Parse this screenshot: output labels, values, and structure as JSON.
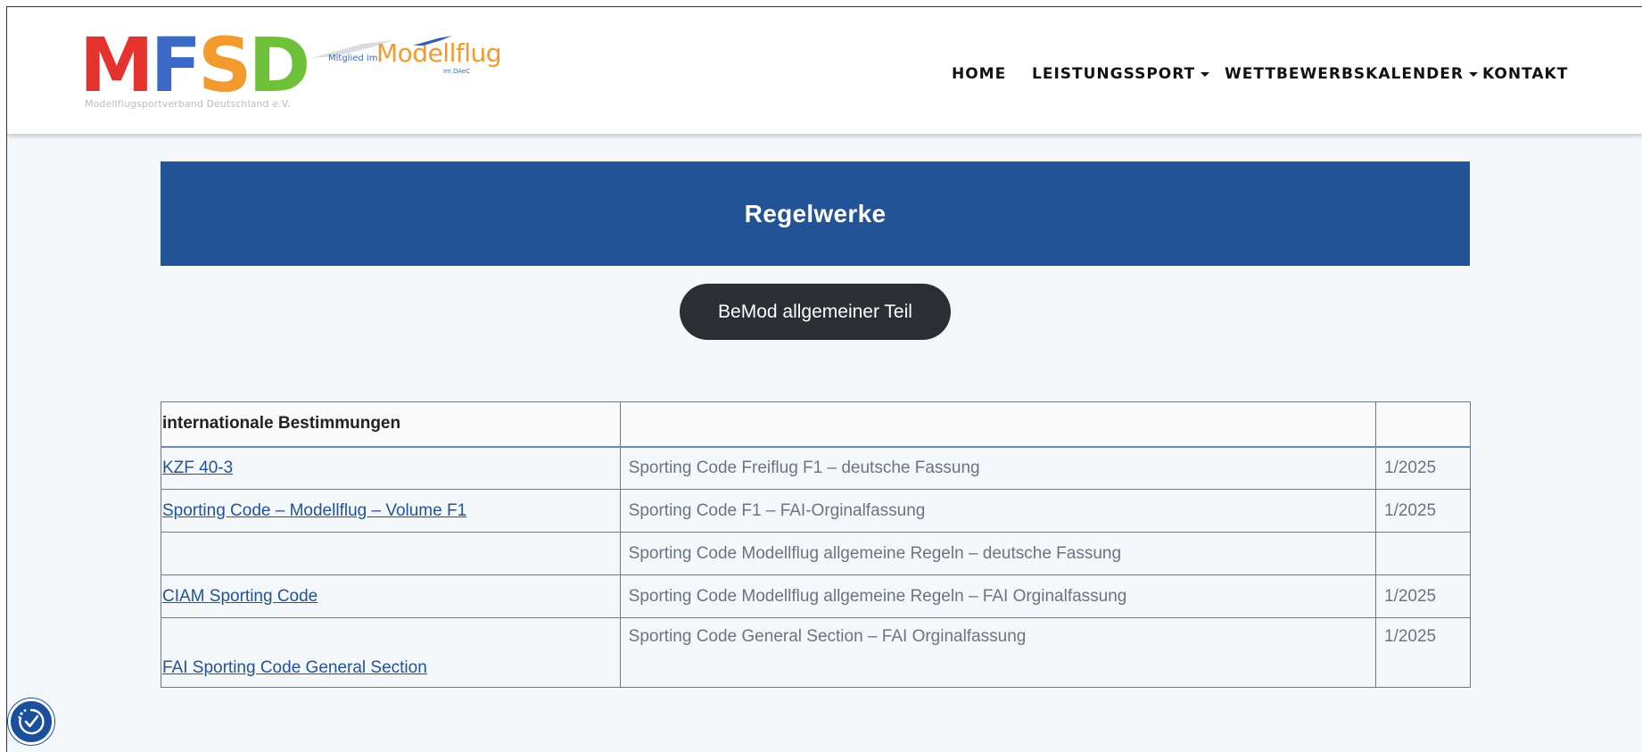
{
  "brand": {
    "letters": [
      "M",
      "F",
      "S",
      "D"
    ],
    "letter_colors": [
      "#e4332f",
      "#3a69c6",
      "#f29a2e",
      "#6ec23a"
    ],
    "subtitle": "Modellflugsportverband Deutschland e.V.",
    "mitglied": "Mitglied im",
    "modellflug": "Modellflug",
    "daec": "im DAeC"
  },
  "nav": {
    "items": [
      {
        "label": "HOME",
        "dropdown": false
      },
      {
        "label": "LEISTUNGSSPORT",
        "dropdown": true
      },
      {
        "label": "WETTBEWERBSKALENDER",
        "dropdown": true
      },
      {
        "label": "KONTAKT",
        "dropdown": false
      }
    ]
  },
  "banner": {
    "title": "Regelwerke",
    "color": "#235397"
  },
  "pill_button": {
    "label": "BeMod allgemeiner Teil"
  },
  "table": {
    "header": [
      "internationale Bestimmungen",
      "",
      ""
    ],
    "rows": [
      {
        "link": "KZF 40-3",
        "description": "Sporting Code Freiflug F1 – deutsche Fassung",
        "version": "1/2025"
      },
      {
        "link": "Sporting Code – Modellflug – Volume F1",
        "description": "Sporting Code F1 – FAI-Orginalfassung",
        "version": "1/2025"
      },
      {
        "link": "",
        "description": "Sporting Code Modellflug allgemeine Regeln – deutsche Fassung",
        "version": ""
      },
      {
        "link": "CIAM Sporting Code",
        "description": "Sporting Code Modellflug allgemeine Regeln – FAI Orginalfassung",
        "version": "1/2025"
      },
      {
        "link": "FAI Sporting Code General Section",
        "description": "Sporting Code General Section – FAI Orginalfassung",
        "version": "1/2025"
      }
    ]
  },
  "accessibility": {
    "icon": "accessibility-icon"
  }
}
